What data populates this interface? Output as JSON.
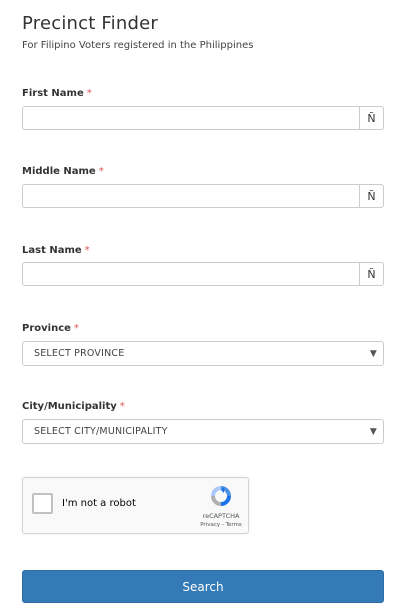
{
  "header": {
    "title": "Precinct Finder",
    "subtitle": "For Filipino Voters registered in the Philippines"
  },
  "form": {
    "required_marker": "*",
    "first_name": {
      "label": "First Name",
      "value": "",
      "addon": "Ñ"
    },
    "middle_name": {
      "label": "Middle Name",
      "value": "",
      "addon": "Ñ"
    },
    "last_name": {
      "label": "Last Name",
      "value": "",
      "addon": "Ñ"
    },
    "province": {
      "label": "Province",
      "selected": "SELECT PROVINCE"
    },
    "city": {
      "label": "City/Municipality",
      "selected": "SELECT CITY/MUNICIPALITY"
    }
  },
  "captcha": {
    "label": "I'm not a robot",
    "brand": "reCAPTCHA",
    "privacy": "Privacy",
    "separator": " - ",
    "terms": "Terms",
    "icon": "recaptcha-logo"
  },
  "search_button": {
    "label": "Search"
  },
  "colors": {
    "primary": "#337ab7",
    "required": "#e05050",
    "border": "#cccccc"
  }
}
